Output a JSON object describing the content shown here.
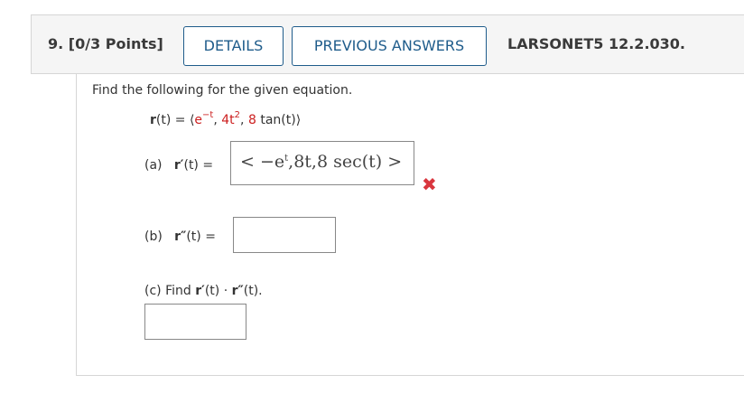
{
  "header": {
    "question_number": "9.",
    "points": "[0/3 Points]",
    "details_label": "DETAILS",
    "previous_answers_label": "PREVIOUS ANSWERS",
    "source": "LARSONET5 12.2.030."
  },
  "problem": {
    "prompt": "Find the following for the given equation.",
    "equation": {
      "lhs": "r",
      "lhs_arg": "(t) = ",
      "open": "⟨",
      "c1_base": "e",
      "c1_exp": "−t",
      "sep1": ", ",
      "c2_coef": "4t",
      "c2_exp": "2",
      "sep2": ", ",
      "c3_coef": "8",
      "c3_rest": " tan(t)",
      "close": "⟩"
    }
  },
  "parts": {
    "a": {
      "letter": "(a)",
      "label_bold": "r′",
      "label_rest": "(t) =",
      "answer_main": "< −e",
      "answer_sup": "t",
      "answer_rest": ",8t,8 sec(t) >",
      "status_icon": "incorrect-x-icon",
      "status_color": "#d9363e"
    },
    "b": {
      "letter": "(b)",
      "label_bold": "r″",
      "label_rest": "(t) =",
      "answer": ""
    },
    "c": {
      "text_pre": "(c) Find ",
      "r1_bold": "r′",
      "r1_rest": "(t) · ",
      "r2_bold": "r″",
      "r2_rest": "(t).",
      "answer": ""
    }
  },
  "colors": {
    "accent": "#1f5c8b",
    "highlight": "#cc1f1f"
  }
}
